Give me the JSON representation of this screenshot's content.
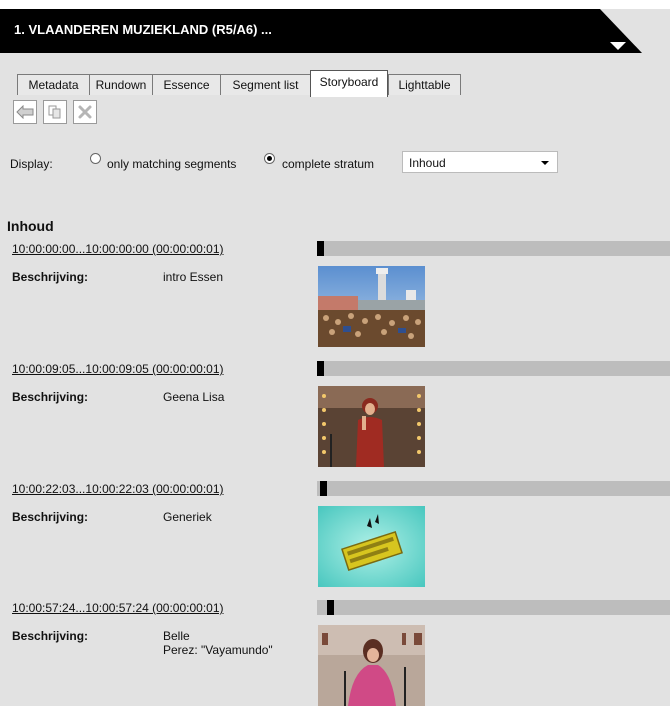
{
  "window": {
    "title": "1. VLAANDEREN MUZIEKLAND (R5/A6) ..."
  },
  "tabs": [
    {
      "label": "Metadata"
    },
    {
      "label": "Rundown"
    },
    {
      "label": "Essence"
    },
    {
      "label": "Segment list"
    },
    {
      "label": "Storyboard",
      "active": true
    },
    {
      "label": "Lighttable"
    }
  ],
  "toolbar": {
    "buttons": [
      "back-arrow-icon",
      "copy-icon",
      "delete-icon"
    ]
  },
  "display": {
    "label": "Display:",
    "option_matching": "only matching segments",
    "option_complete": "complete stratum",
    "selected_option": "complete stratum",
    "stratum_select": "Inhoud"
  },
  "section": {
    "title": "Inhoud"
  },
  "segments": [
    {
      "timecode": "10:00:00:00...10:00:00:00 (00:00:00:01)",
      "label": "Beschrijving:",
      "description": "intro Essen",
      "position": 0.0
    },
    {
      "timecode": "10:00:09:05...10:00:09:05 (00:00:00:01)",
      "label": "Beschrijving:",
      "description": "Geena Lisa",
      "position": 0.0
    },
    {
      "timecode": "10:00:22:03...10:00:22:03 (00:00:00:01)",
      "label": "Beschrijving:",
      "description": "Generiek",
      "position": 0.01
    },
    {
      "timecode": "10:00:57:24...10:00:57:24 (00:00:00:01)",
      "label": "Beschrijving:",
      "description_line1": "Belle",
      "description_line2": "Perez: \"Vayamundo\"",
      "position": 0.03
    }
  ],
  "colors": {
    "titlebar": "#000000",
    "track": "#bdbdbd",
    "background": "#e2e2e2"
  }
}
